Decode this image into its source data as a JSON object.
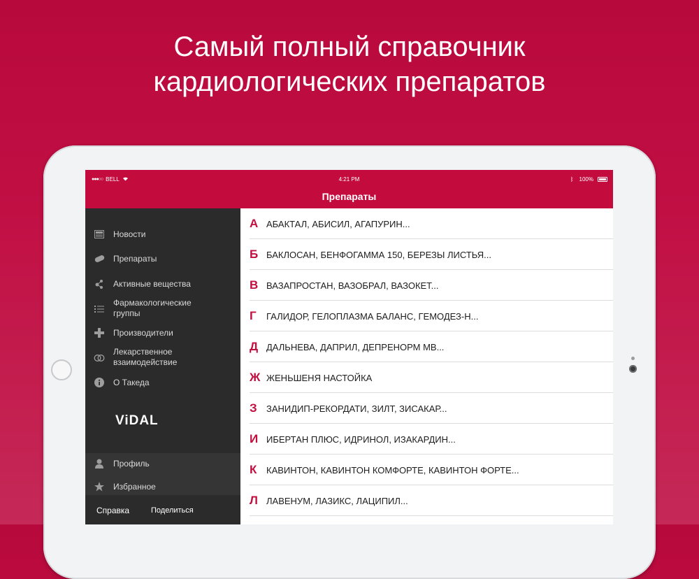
{
  "headline": {
    "line1": "Самый полный справочник",
    "line2": "кардиологических препаратов"
  },
  "status_bar": {
    "carrier": "BELL",
    "time": "4:21 PM",
    "battery": "100%"
  },
  "nav_title": "Препараты",
  "sidebar": {
    "items": [
      {
        "label": "Новости",
        "icon": "newspaper-icon"
      },
      {
        "label": "Препараты",
        "icon": "pill-icon"
      },
      {
        "label": "Активные вещества",
        "icon": "molecule-icon"
      },
      {
        "label": "Фармакологические группы",
        "icon": "list-icon"
      },
      {
        "label": "Производители",
        "icon": "plus-icon"
      },
      {
        "label": "Лекарственное взаимодействие",
        "icon": "interaction-icon"
      },
      {
        "label": "О Такеда",
        "icon": "info-icon"
      }
    ],
    "logo": "ViDAL",
    "profile": {
      "label": "Профиль",
      "icon": "person-icon"
    },
    "favorites": {
      "label": "Избранное",
      "icon": "star-icon"
    },
    "help": "Справка",
    "share": "Поделиться"
  },
  "drug_list": [
    {
      "letter": "А",
      "text": "АБАКТАЛ, АБИСИЛ, АГАПУРИН..."
    },
    {
      "letter": "Б",
      "text": "БАКЛОСАН, БЕНФОГАММА 150, БЕРЕЗЫ ЛИСТЬЯ..."
    },
    {
      "letter": "В",
      "text": "ВАЗАПРОСТАН, ВАЗОБРАЛ, ВАЗОКЕТ..."
    },
    {
      "letter": "Г",
      "text": "ГАЛИДОР, ГЕЛОПЛАЗМА БАЛАНС, ГЕМОДЕЗ-Н..."
    },
    {
      "letter": "Д",
      "text": "ДАЛЬНЕВА, ДАПРИЛ, ДЕПРЕНОРМ МВ..."
    },
    {
      "letter": "Ж",
      "text": "ЖЕНЬШЕНЯ НАСТОЙКА"
    },
    {
      "letter": "З",
      "text": "ЗАНИДИП-РЕКОРДАТИ, ЗИЛТ, ЗИСАКАР..."
    },
    {
      "letter": "И",
      "text": "ИБЕРТАН ПЛЮС, ИДРИНОЛ, ИЗАКАРДИН..."
    },
    {
      "letter": "К",
      "text": "КАВИНТОН, КАВИНТОН КОМФОРТЕ, КАВИНТОН ФОРТЕ..."
    },
    {
      "letter": "Л",
      "text": "ЛАВЕНУМ, ЛАЗИКС, ЛАЦИПИЛ..."
    }
  ],
  "colors": {
    "brand": "#c30b3d",
    "sidebar_bg": "#2b2b2b",
    "letter": "#c10f3f"
  }
}
